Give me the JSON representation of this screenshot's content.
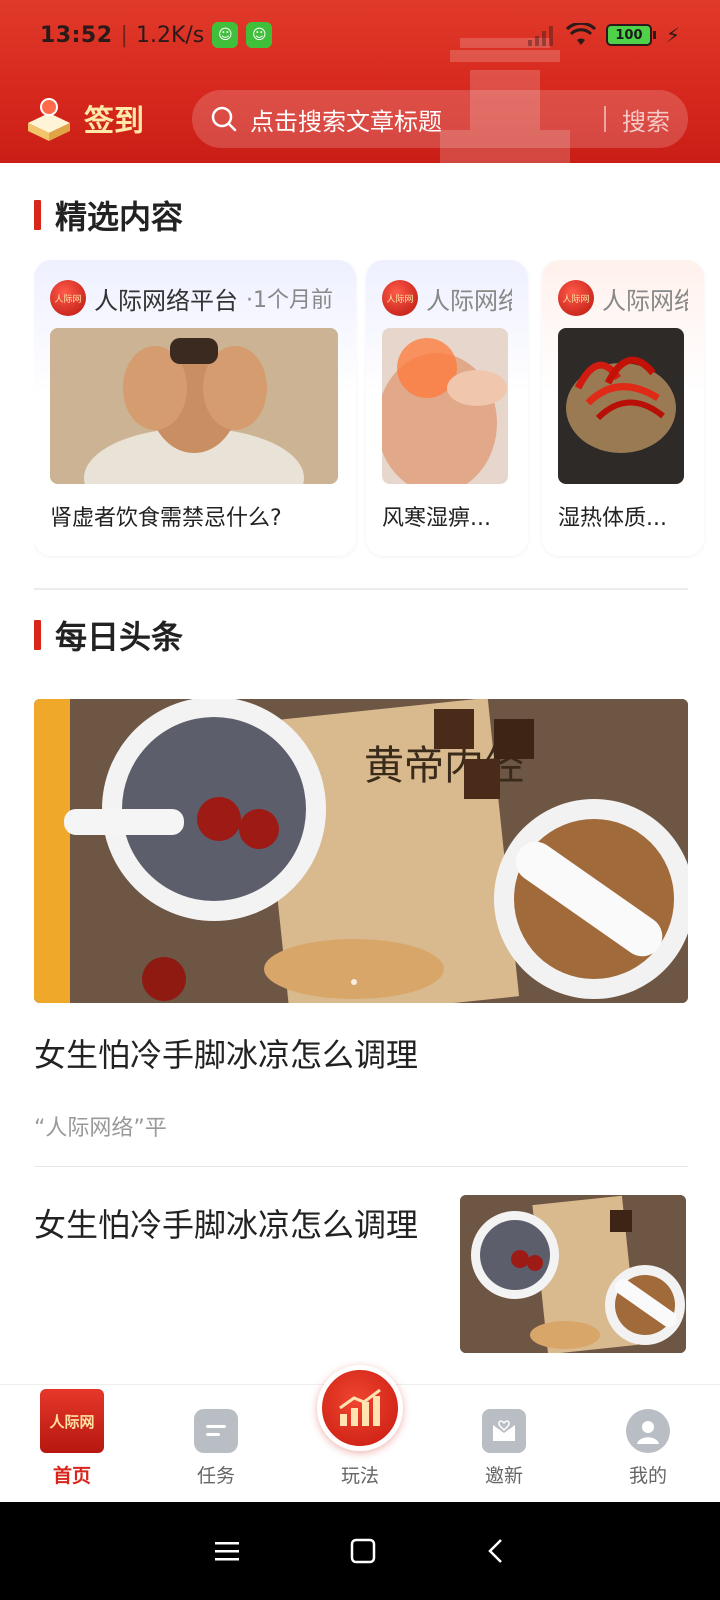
{
  "status_bar": {
    "time": "13:52",
    "speed": "1.2K/s",
    "battery": "100"
  },
  "header": {
    "signin_label": "签到",
    "search_placeholder": "点击搜索文章标题",
    "search_button": "搜索"
  },
  "featured": {
    "title": "精选内容",
    "cards": [
      {
        "source": "人际网络平台",
        "time": "·1个月前",
        "title": "肾虚者饮食需禁忌什么?"
      },
      {
        "source": "人际网络..",
        "title": "风寒湿痹..."
      },
      {
        "source": "人际网络..",
        "title": "湿热体质..."
      }
    ]
  },
  "daily": {
    "title": "每日头条",
    "banner_caption": "黄帝内经",
    "items": [
      {
        "headline": "女生怕冷手脚冰凉怎么调理",
        "source": "“人际网络”平"
      },
      {
        "headline": "女生怕冷手脚冰凉怎么调理"
      }
    ]
  },
  "tabbar": {
    "tabs": [
      {
        "label": "首页",
        "logo_text": "人际网",
        "active": true
      },
      {
        "label": "任务"
      },
      {
        "label": "玩法"
      },
      {
        "label": "邀新"
      },
      {
        "label": "我的"
      }
    ]
  },
  "colors": {
    "brand_red": "#d9261c",
    "signin_gold": "#ffe9a8"
  }
}
